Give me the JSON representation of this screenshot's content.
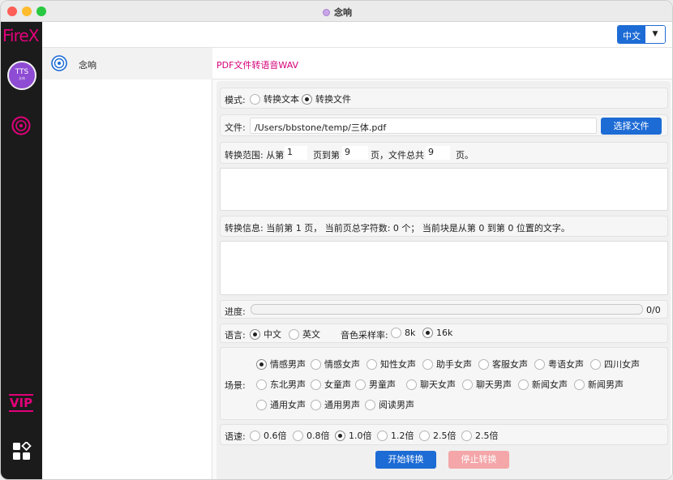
{
  "window": {
    "title": "念响"
  },
  "rail": {
    "logo": "FireX",
    "tts_label": "TTS",
    "tts_sub": "念响",
    "vip_label": "VIP"
  },
  "topbar": {
    "language_value": "中文"
  },
  "sidebar": {
    "items": [
      {
        "label": "念响"
      }
    ]
  },
  "main": {
    "title": "PDF文件转语音WAV",
    "mode": {
      "label": "模式:",
      "options": [
        "转换文本",
        "转换文件"
      ],
      "selected": "转换文件"
    },
    "file": {
      "label": "文件:",
      "path": "/Users/bbstone/temp/三体.pdf",
      "button": "选择文件"
    },
    "range": {
      "label": "转换范围: 从第",
      "from": "1",
      "to_label": "页到第",
      "to": "9",
      "total_label": "页，文件总共",
      "total": "9",
      "end_label": "页。"
    },
    "info": {
      "text": "转换信息:  当前第 1 页，  当前页总字符数: 0 个；  当前块是从第 0 到第 0 位置的文字。"
    },
    "progress": {
      "label": "进度:",
      "value_text": "0/0",
      "fraction": 0
    },
    "language": {
      "label": "语言:",
      "options": [
        "中文",
        "英文"
      ],
      "selected": "中文"
    },
    "sample_rate": {
      "label": "音色采样率:",
      "options": [
        "8k",
        "16k"
      ],
      "selected": "16k"
    },
    "scene": {
      "label": "场景:",
      "rows": [
        [
          "情感男声",
          "情感女声",
          "知性女声",
          "助手女声",
          "客服女声",
          "粤语女声",
          "四川女声"
        ],
        [
          "东北男声",
          "女童声",
          "男童声",
          "聊天女声",
          "聊天男声",
          "新闻女声",
          "新闻男声"
        ],
        [
          "通用女声",
          "通用男声",
          "阅读男声"
        ]
      ],
      "selected": "情感男声"
    },
    "speed": {
      "label": "语速:",
      "options": [
        "0.6倍",
        "0.8倍",
        "1.0倍",
        "1.2倍",
        "2.5倍",
        "2.5倍"
      ],
      "selected_index": 2
    },
    "start_button": "开始转换",
    "stop_button": "停止转换"
  },
  "colors": {
    "accent": "#1d6bd5",
    "brand": "#e2007a",
    "rail_bg": "#1b1b1b",
    "stop_button": "#f4a6a8"
  }
}
